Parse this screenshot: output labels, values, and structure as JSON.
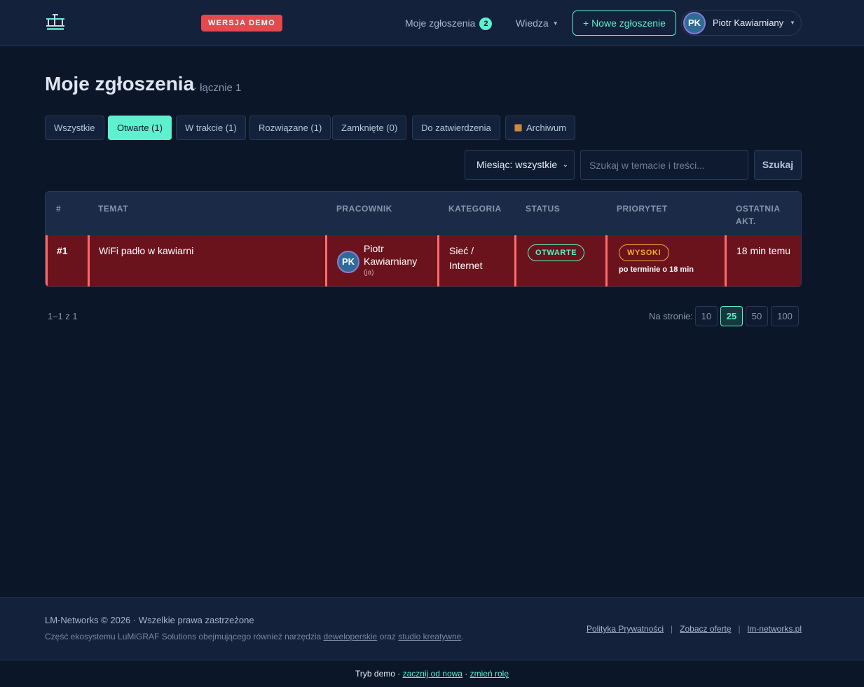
{
  "header": {
    "demo_badge": "WERSJA DEMO",
    "nav_my_tickets": "Moje zgłoszenia",
    "nav_my_tickets_count": "2",
    "nav_knowledge": "Wiedza",
    "new_ticket_button": "+ Nowe zgłoszenie",
    "user": {
      "initials": "PK",
      "name": "Piotr Kawiarniany"
    }
  },
  "page": {
    "title": "Moje zgłoszenia",
    "subtitle": "· łącznie 1"
  },
  "tabs": [
    {
      "label": "Wszystkie",
      "active": false
    },
    {
      "label": "Otwarte (1)",
      "active": true
    },
    {
      "label": "W trakcie (1)",
      "active": false
    },
    {
      "label": "Rozwiązane (1)",
      "active": false
    },
    {
      "label": "Zamknięte (0)",
      "active": false
    },
    {
      "label": "Do zatwierdzenia",
      "active": false
    },
    {
      "label": "Archiwum",
      "active": false,
      "icon": "package-icon"
    }
  ],
  "filters": {
    "month_select": "Miesiąc: wszystkie",
    "search_placeholder": "Szukaj w temacie i treści...",
    "search_button": "Szukaj"
  },
  "table": {
    "headers": [
      "#",
      "TEMAT",
      "PRACOWNIK",
      "KATEGORIA",
      "STATUS",
      "PRIORYTET",
      "OSTATNIA AKT."
    ],
    "rows": [
      {
        "id": "#1",
        "subject": "WiFi padło w kawiarni",
        "employee_initials": "PK",
        "employee_name": "Piotr Kawiarniany",
        "employee_note": "(ja)",
        "category": "Sieć / Internet",
        "status": "OTWARTE",
        "priority": "WYSOKI",
        "overdue": "po terminie o 18 min",
        "last_activity": "18 min temu"
      }
    ]
  },
  "pagination": {
    "range": "1–1 z 1",
    "per_page_label": "Na stronie:",
    "options": [
      "10",
      "25",
      "50",
      "100"
    ],
    "selected": "25"
  },
  "footer": {
    "copyright": "LM-Networks © 2026 · Wszelkie prawa zastrzeżone",
    "eco_prefix": "Część ekosystemu LuMiGRAF Solutions obejmującego również narzędzia ",
    "eco_link1": "deweloperskie",
    "eco_mid": " oraz ",
    "eco_link2": "studio kreatywne",
    "eco_suffix": ".",
    "links": [
      "Polityka Prywatności",
      "Zobacz ofertę",
      "lm-networks.pl"
    ]
  },
  "demo_bar": {
    "prefix": "Tryb demo · ",
    "restart": "zacznij od nowa",
    "mid": " · ",
    "change_role": "zmień rolę"
  },
  "colors": {
    "accent": "#5ef1d0",
    "background": "#0b1629",
    "panel": "#13213b",
    "overdue_row": "#6b131d",
    "overdue_border": "#ff6b6b",
    "priority_high": "#f2a93b",
    "demo_badge": "#e5484d"
  }
}
